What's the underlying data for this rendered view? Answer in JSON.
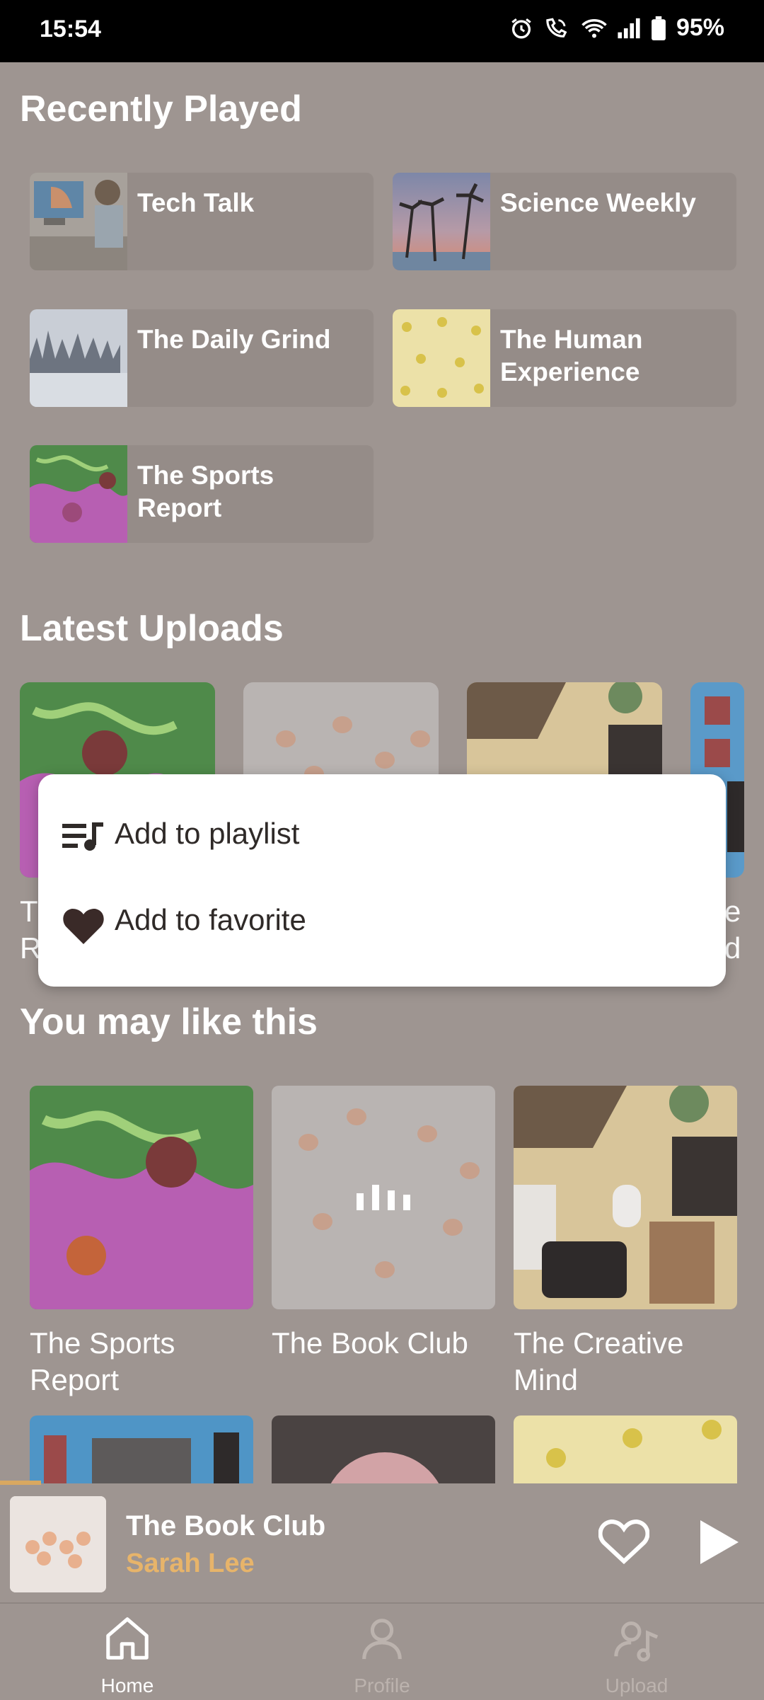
{
  "status_bar": {
    "time": "15:54",
    "battery": "95%"
  },
  "recently_played": {
    "title": "Recently Played",
    "items": [
      {
        "label": "Tech Talk"
      },
      {
        "label": "Science Weekly"
      },
      {
        "label": "The Daily Grind"
      },
      {
        "label": "The Human Experience"
      },
      {
        "label": "The Sports Report"
      }
    ]
  },
  "latest_uploads": {
    "title": "Latest Uploads"
  },
  "you_may_like": {
    "title": "You may like this",
    "items": [
      {
        "title": "The Sports Report"
      },
      {
        "title": "The Book Club"
      },
      {
        "title": "The Creative Mind"
      }
    ]
  },
  "context_menu": {
    "items": [
      {
        "label": "Add to playlist",
        "icon": "playlist-add-icon"
      },
      {
        "label": "Add to favorite",
        "icon": "heart-filled-icon"
      }
    ]
  },
  "now_playing": {
    "title": "The Book Club",
    "artist": "Sarah Lee",
    "progress": 0.05
  },
  "bottom_nav": {
    "items": [
      {
        "label": "Home",
        "icon": "home-icon",
        "active": true
      },
      {
        "label": "Profile",
        "icon": "profile-icon",
        "active": false
      },
      {
        "label": "Upload",
        "icon": "upload-icon",
        "active": false
      }
    ]
  },
  "colors": {
    "scrim_background": "#9e9591",
    "accent": "#e7b46a",
    "menu_text": "#2f2a28"
  }
}
